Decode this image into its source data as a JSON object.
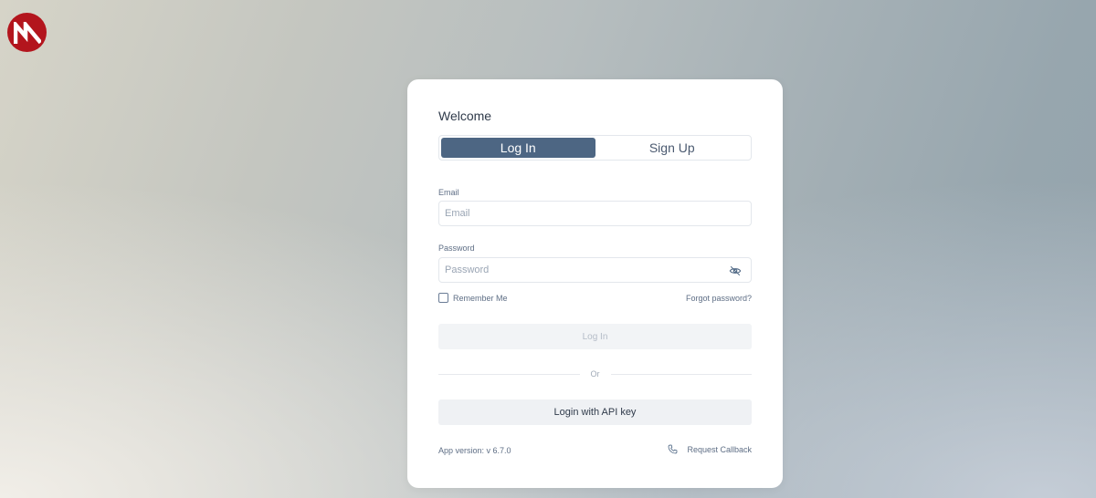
{
  "brand": {
    "logo_icon": "brand-logo-icon",
    "color": "#b3151d"
  },
  "card": {
    "title": "Welcome",
    "tabs": [
      {
        "label": "Log In",
        "active": true
      },
      {
        "label": "Sign Up",
        "active": false
      }
    ],
    "email": {
      "label": "Email",
      "placeholder": "Email",
      "value": ""
    },
    "password": {
      "label": "Password",
      "placeholder": "Password",
      "value": "",
      "toggle_icon": "eye-off-icon"
    },
    "remember_me": {
      "label": "Remember Me",
      "checked": false
    },
    "forgot_password": "Forgot password?",
    "login_button": "Log In",
    "divider_text": "Or",
    "api_key_button": "Login with API key",
    "app_version": "App version: v 6.7.0",
    "request_callback": {
      "label": "Request Callback",
      "icon": "phone-icon"
    }
  },
  "colors": {
    "accent": "#4d6683",
    "muted_text": "#5e6e85"
  }
}
